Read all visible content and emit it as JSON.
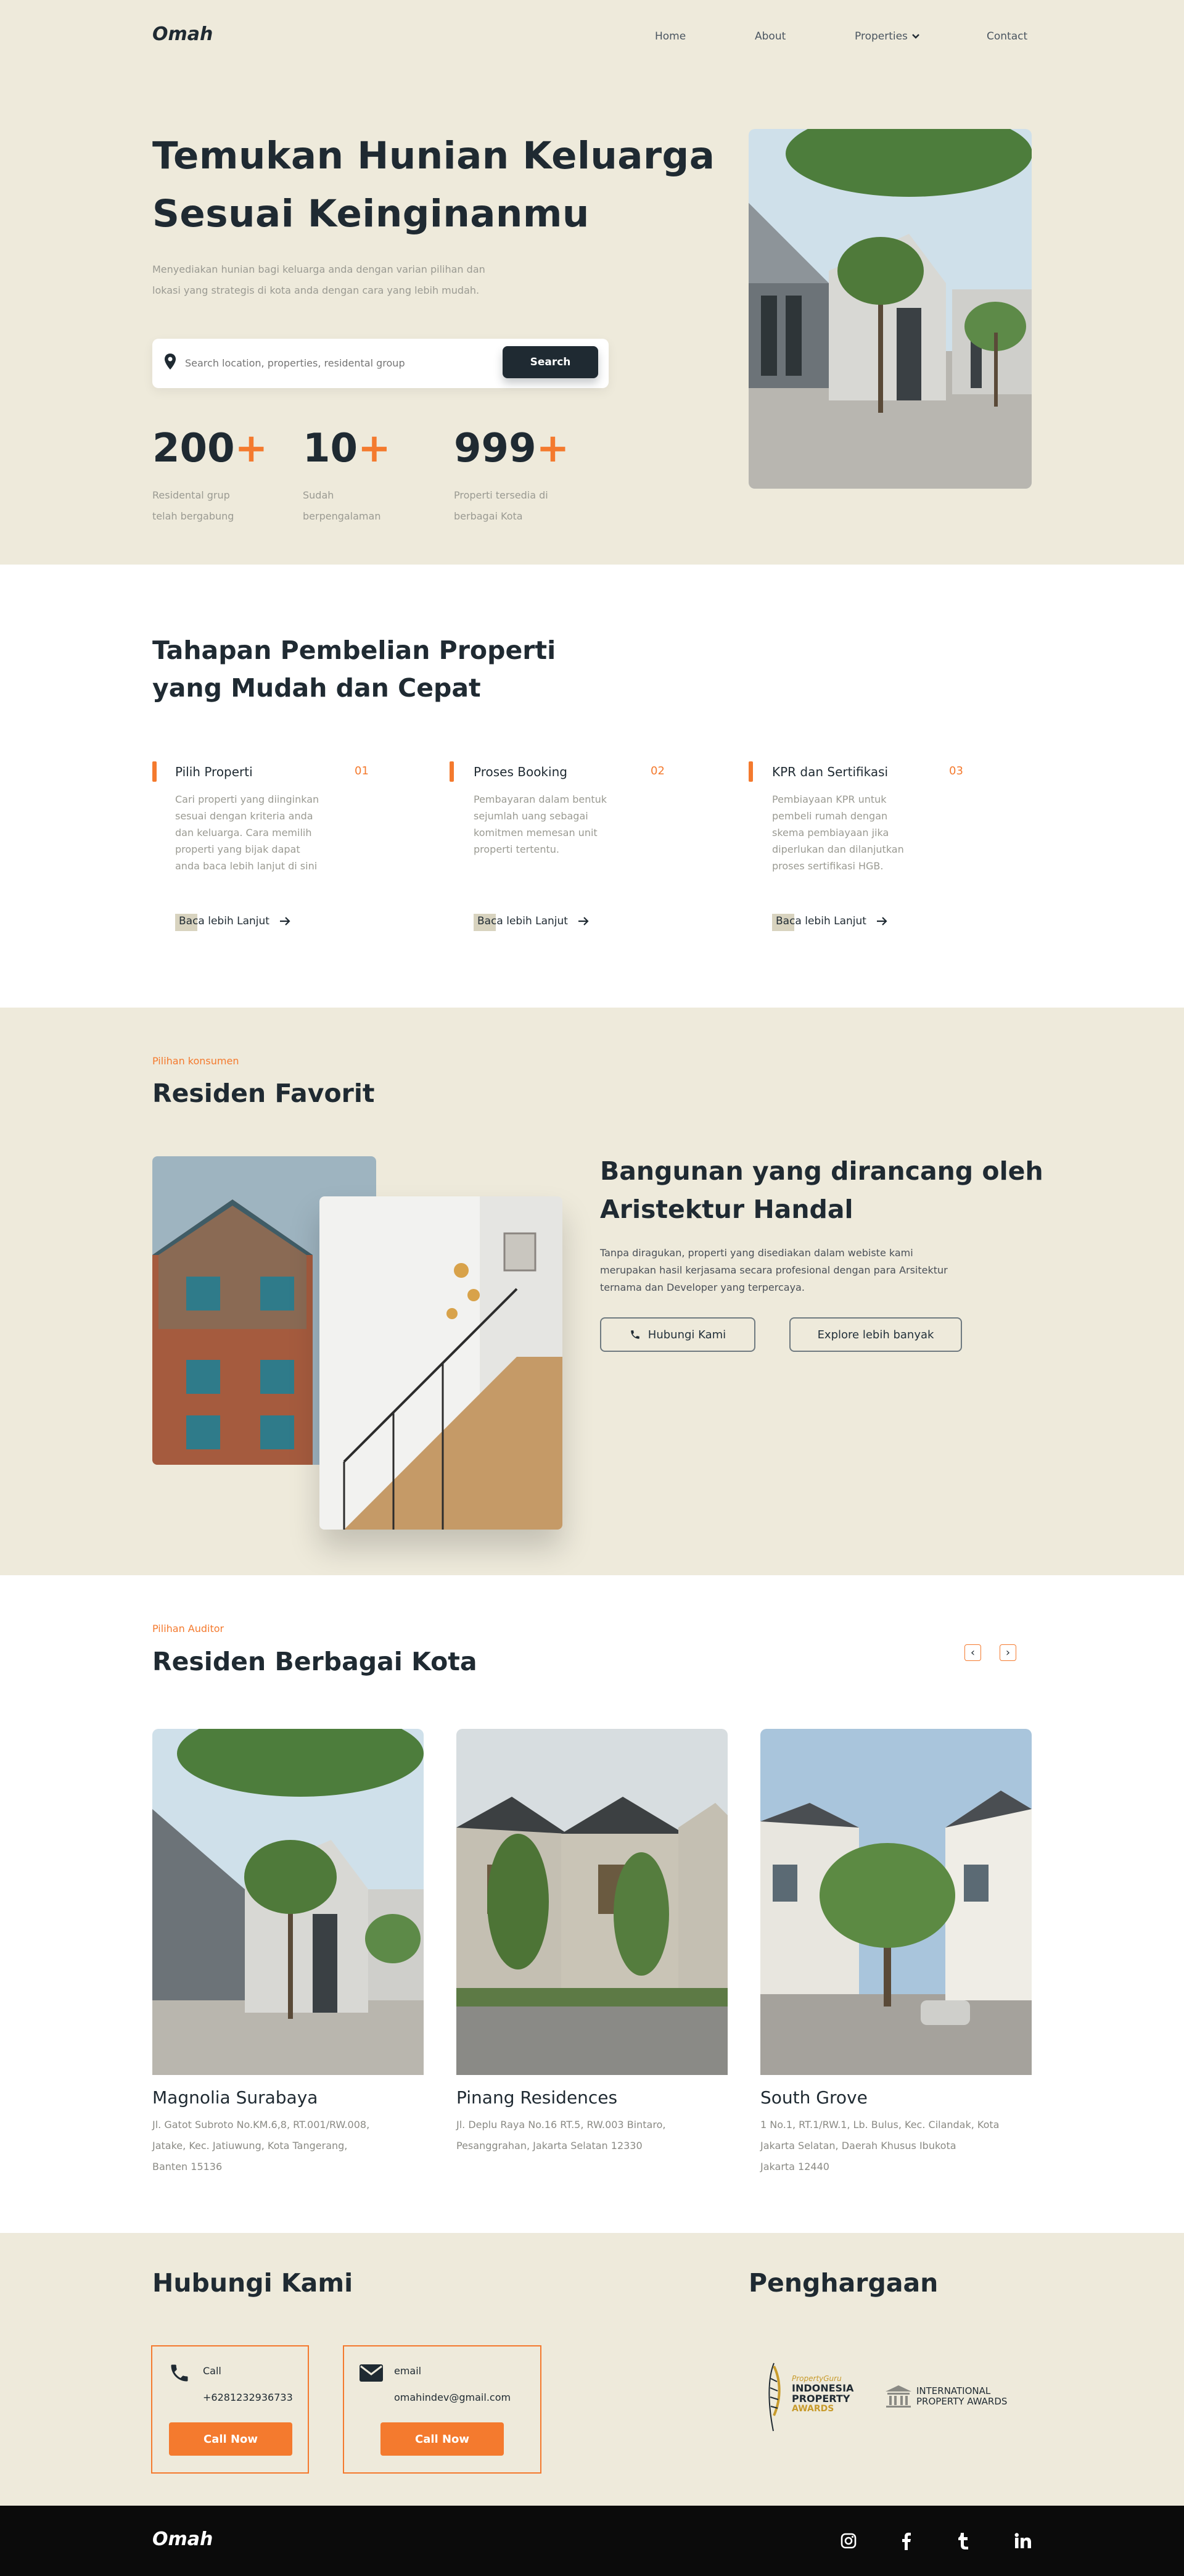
{
  "nav": {
    "logo": "Omah",
    "home": "Home",
    "about": "About",
    "properties": "Properties",
    "contact": "Contact"
  },
  "hero": {
    "title_line1": "Temukan Hunian Keluarga",
    "title_line2": "Sesuai Keinginanmu",
    "desc_line1": "Menyediakan hunian bagi keluarga anda dengan varian pilihan dan",
    "desc_line2": "lokasi yang strategis di kota anda dengan cara yang lebih mudah.",
    "search_placeholder": "Search location, properties, residental group",
    "search_button": "Search",
    "stats": [
      {
        "num": "200",
        "plus": "+",
        "l1": "Residental grup",
        "l2": "telah bergabung"
      },
      {
        "num": "10",
        "plus": "+",
        "l1": "Sudah",
        "l2": "berpengalaman"
      },
      {
        "num": "999",
        "plus": "+",
        "l1": "Properti tersedia di",
        "l2": "berbagai Kota"
      }
    ]
  },
  "steps": {
    "title_line1": "Tahapan Pembelian Properti",
    "title_line2": "yang Mudah dan Cepat",
    "items": [
      {
        "title": "Pilih Properti",
        "no": "01",
        "d1": "Cari properti yang diinginkan",
        "d2": "sesuai dengan kriteria anda",
        "d3": "dan keluarga. Cara memilih",
        "d4": "properti yang bijak dapat",
        "d5": "anda baca lebih lanjut di sini",
        "link": "Baca lebih Lanjut"
      },
      {
        "title": "Proses Booking",
        "no": "02",
        "d1": "Pembayaran dalam bentuk",
        "d2": "sejumlah uang sebagai",
        "d3": "komitmen memesan unit",
        "d4": "properti tertentu.",
        "d5": "",
        "link": "Baca lebih Lanjut"
      },
      {
        "title": "KPR dan Sertifikasi",
        "no": "03",
        "d1": "Pembiayaan KPR untuk",
        "d2": "pembeli rumah dengan",
        "d3": "skema pembiayaan jika",
        "d4": "diperlukan dan dilanjutkan",
        "d5": "proses sertifikasi HGB.",
        "link": "Baca lebih Lanjut"
      }
    ]
  },
  "favorit": {
    "eyebrow": "Pilihan konsumen",
    "title": "Residen Favorit",
    "heading_line1": "Bangunan yang dirancang oleh",
    "heading_line2": "Aristektur Handal",
    "desc_line1": "Tanpa diragukan, properti yang disediakan dalam webiste kami",
    "desc_line2": "merupakan hasil kerjasama secara profesional dengan para Arsitektur",
    "desc_line3": "ternama dan Developer yang terpercaya.",
    "btn_contact": "Hubungi Kami",
    "btn_explore": "Explore lebih banyak"
  },
  "cities": {
    "eyebrow": "Pilihan Auditor",
    "title": "Residen Berbagai Kota",
    "prev": "‹",
    "next": "›",
    "items": [
      {
        "name": "Magnolia Surabaya",
        "a1": "Jl. Gatot Subroto No.KM.6,8, RT.001/RW.008,",
        "a2": "Jatake, Kec. Jatiuwung, Kota Tangerang,",
        "a3": "Banten 15136"
      },
      {
        "name": "Pinang Residences",
        "a1": "Jl. Deplu Raya No.16 RT.5, RW.003 Bintaro,",
        "a2": "Pesanggrahan, Jakarta Selatan 12330",
        "a3": ""
      },
      {
        "name": "South Grove",
        "a1": "1 No.1, RT.1/RW.1, Lb. Bulus, Kec. Cilandak, Kota",
        "a2": "Jakarta Selatan, Daerah Khusus Ibukota",
        "a3": "Jakarta 12440"
      }
    ]
  },
  "contact": {
    "title": "Hubungi Kami",
    "call_label": "Call",
    "phone": "+6281232936733",
    "call_button": "Call Now",
    "email_label": "email",
    "email": "omahindev@gmail.com",
    "email_button": "Call Now"
  },
  "awards": {
    "title": "Penghargaan",
    "a1_small": "PropertyGuru",
    "a1_l1": "INDONESIA",
    "a1_l2": "PROPERTY",
    "a1_l3": "AWARDS",
    "a2_l1": "INTERNATIONAL",
    "a2_l2": "PROPERTY AWARDS"
  },
  "footer": {
    "logo": "Omah"
  },
  "colors": {
    "accent": "#f47a2e",
    "dark": "#1f2a32",
    "cream": "#eeeadb",
    "footer": "#0b0b0b"
  }
}
